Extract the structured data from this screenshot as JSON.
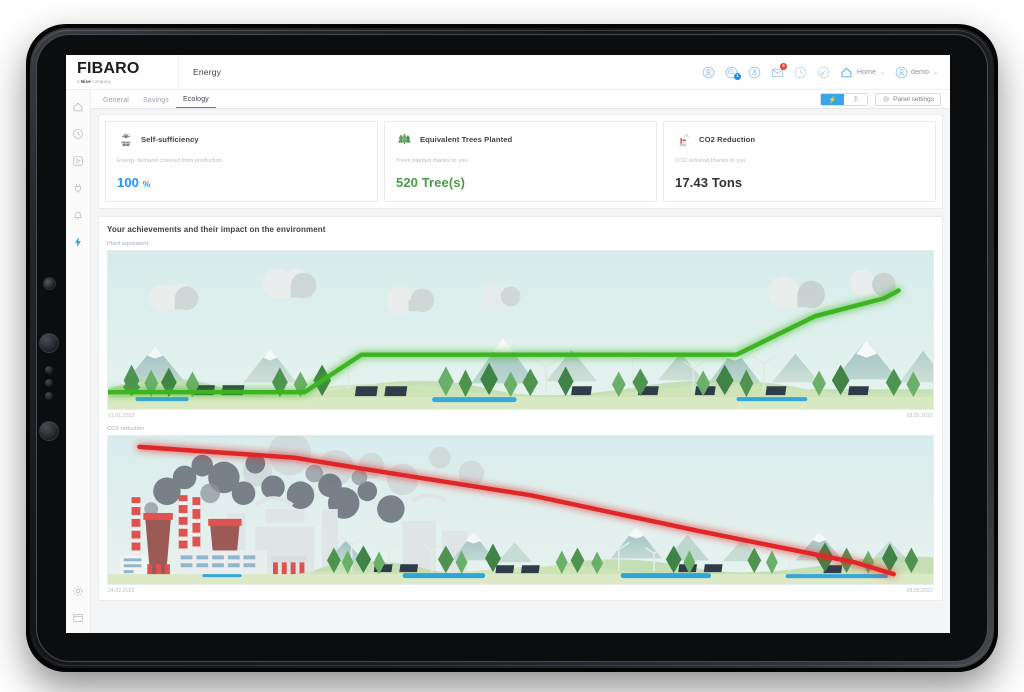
{
  "app": {
    "brand": "FIBARO",
    "brand_sub_pre": "a ",
    "brand_sub_bold": "Nice",
    "brand_sub_post": " company",
    "page_title": "Energy"
  },
  "topbar": {
    "icons": [
      {
        "name": "user-account-icon",
        "label": "Account"
      },
      {
        "name": "cloud-sync-icon",
        "label": "Cloud",
        "badge": "1",
        "badge_color": "#1a8fe3"
      },
      {
        "name": "voice-assistant-icon",
        "label": "Voice assistant"
      },
      {
        "name": "messages-icon",
        "label": "Messages",
        "badge": "4",
        "badge_color": "#ee4036"
      },
      {
        "name": "history-icon",
        "label": "History"
      },
      {
        "name": "diagnostics-icon",
        "label": "Diagnostics"
      }
    ],
    "home_menu": "Home",
    "user_menu": "demo",
    "caret": "⌄"
  },
  "tabs": {
    "items": [
      {
        "label": "General",
        "active": false
      },
      {
        "label": "Savings",
        "active": false
      },
      {
        "label": "Ecology",
        "active": true
      }
    ],
    "unit_toggle": [
      {
        "label": "⚡",
        "name": "energy-unit-option",
        "active": true
      },
      {
        "label": "$",
        "name": "currency-unit-option",
        "active": false
      }
    ],
    "panel_settings": "Panel settings"
  },
  "sidebar": {
    "items": [
      {
        "name": "sidebar-item-home",
        "label": "Home"
      },
      {
        "name": "sidebar-item-history",
        "label": "History"
      },
      {
        "name": "sidebar-item-scenes",
        "label": "Scenes"
      },
      {
        "name": "sidebar-item-devices",
        "label": "Devices"
      },
      {
        "name": "sidebar-item-alarm",
        "label": "Alarm"
      },
      {
        "name": "sidebar-item-energy",
        "label": "Energy",
        "active": true
      }
    ],
    "bottom_items": [
      {
        "name": "sidebar-item-settings",
        "label": "Settings"
      },
      {
        "name": "sidebar-item-panels",
        "label": "Panels"
      }
    ]
  },
  "cards": [
    {
      "icon": "solar-panel-icon",
      "title": "Self-sufficiency",
      "description": "Energy demand covered from production.",
      "value": "100",
      "unit": "%",
      "color": "#2196f3"
    },
    {
      "icon": "trees-icon",
      "title": "Equivalent Trees Planted",
      "description": "Trees planted thanks to you.",
      "value": "520 Tree(s)",
      "unit": "",
      "color": "#4c9a4c"
    },
    {
      "icon": "factory-co2-icon",
      "title": "CO2 Reduction",
      "description": "CO2 reduced thanks to you.",
      "value": "17.43 Tons",
      "unit": "",
      "color": "#2f3337"
    }
  ],
  "achievements": {
    "title": "Your achievements and their impact on the environment",
    "charts": [
      {
        "label": "Plant equivalent",
        "name": "plant-equivalent-chart",
        "line_color": "#3cb522",
        "start_date": "01.01.2022",
        "end_date": "08.05.2022"
      },
      {
        "label": "CO2 reduction",
        "name": "co2-reduction-chart",
        "line_color": "#e02626",
        "start_date": "24.02.2022",
        "end_date": "08.05.2022"
      }
    ]
  },
  "chart_data": [
    {
      "type": "line",
      "name": "plant-equivalent-chart",
      "title": "Plant equivalent",
      "xlabel": "",
      "ylabel": "",
      "line_color": "#3cb522",
      "x": [
        "01.01.2022",
        "27.01.2022",
        "10.02.2022",
        "24.02.2022",
        "16.03.2022",
        "05.04.2022",
        "21.04.2022",
        "08.05.2022"
      ],
      "y": [
        0,
        0,
        0,
        29,
        29,
        29,
        66,
        66
      ],
      "xlim": [
        "01.01.2022",
        "08.05.2022"
      ],
      "ylim": [
        0,
        100
      ],
      "grid": false,
      "legend": "none",
      "annotations": [
        "Landscape illustration background: trees, mountains, solar panels, wind turbines, clouds"
      ]
    },
    {
      "type": "line",
      "name": "co2-reduction-chart",
      "title": "CO2 reduction",
      "xlabel": "",
      "ylabel": "",
      "line_color": "#e02626",
      "x": [
        "24.02.2022",
        "12.03.2022",
        "26.03.2022",
        "14.04.2022",
        "08.05.2022"
      ],
      "y": [
        97,
        92,
        82,
        60,
        5
      ],
      "xlim": [
        "24.02.2022",
        "08.05.2022"
      ],
      "ylim": [
        0,
        100
      ],
      "grid": false,
      "legend": "none",
      "annotations": [
        "Illustration background: smoking factories on the left fading into green landscape on the right"
      ]
    }
  ]
}
